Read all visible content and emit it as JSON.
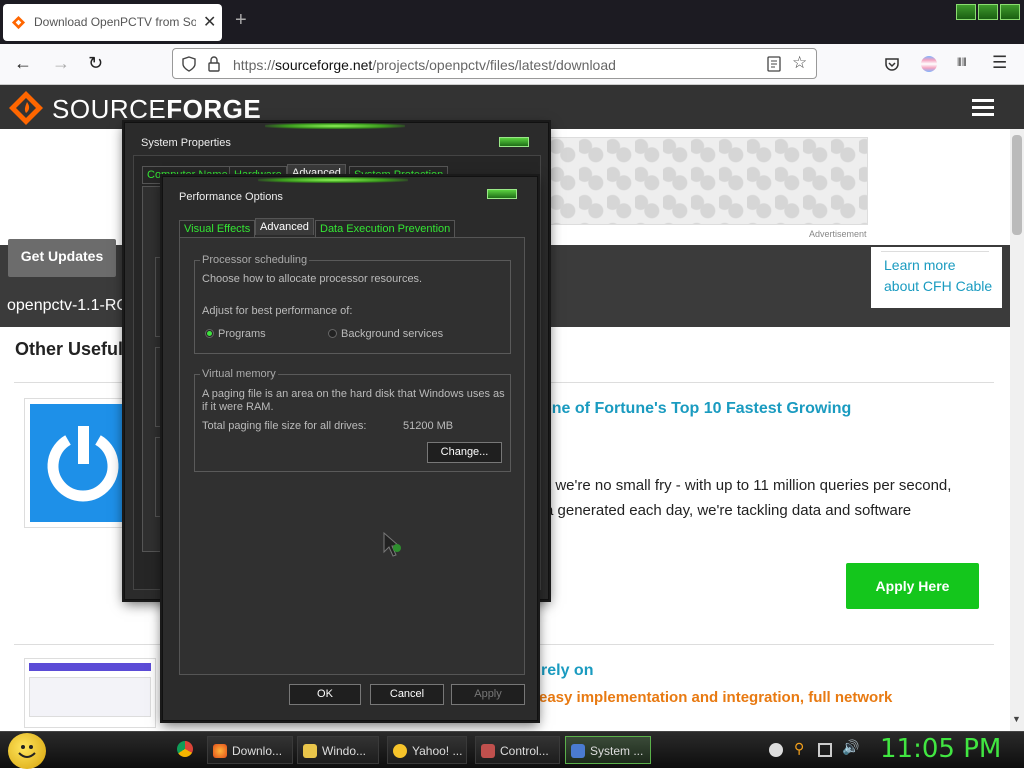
{
  "browser": {
    "tab_title": "Download OpenPCTV from So",
    "url_prefix": "https://",
    "url_host": "sourceforge.net",
    "url_path": "/projects/openpctv/files/latest/download"
  },
  "page": {
    "logo_left": "SOURCE",
    "logo_right": "FORGE",
    "ad_label": "Advertisement",
    "get_updates": "Get Updates",
    "filename": "openpctv-1.1-RC",
    "learn_more_line1": "Learn more",
    "learn_more_line2": "about CFH Cable",
    "other_useful": "Other Useful",
    "promo_title": "one of Fortune's Top 10 Fastest Growing",
    "promo_desc1": "t we're no small fry - with up to 11 million queries per second,",
    "promo_desc2": "a generated each day, we're tackling data and software",
    "apply_here": "Apply Here",
    "promo2_title": "rely on",
    "promo2_sub": "easy implementation and integration, full network"
  },
  "system_properties": {
    "title": "System Properties",
    "tabs": [
      "Computer Name",
      "Hardware",
      "Advanced",
      "System Protection"
    ]
  },
  "performance_options": {
    "title": "Performance Options",
    "tabs": [
      "Visual Effects",
      "Advanced",
      "Data Execution Prevention"
    ],
    "processor_group": "Processor scheduling",
    "processor_desc": "Choose how to allocate processor resources.",
    "adjust_label": "Adjust for best performance of:",
    "radio_programs": "Programs",
    "radio_background": "Background services",
    "vm_group": "Virtual memory",
    "vm_desc1": "A paging file is an area on the hard disk that Windows uses as",
    "vm_desc2": "if it were RAM.",
    "vm_total_label": "Total paging file size for all drives:",
    "vm_total_value": "51200 MB",
    "change_button": "Change...",
    "ok_button": "OK",
    "cancel_button": "Cancel",
    "apply_button": "Apply"
  },
  "taskbar": {
    "items": [
      "Downlo...",
      "Windo...",
      "Yahoo! ...",
      "Control...",
      "System ..."
    ],
    "clock": "11:05 PM"
  },
  "icons": {
    "tab_favicon": "sourceforge-icon",
    "back": "back-arrow-icon",
    "forward": "forward-arrow-icon",
    "reload": "reload-icon"
  }
}
